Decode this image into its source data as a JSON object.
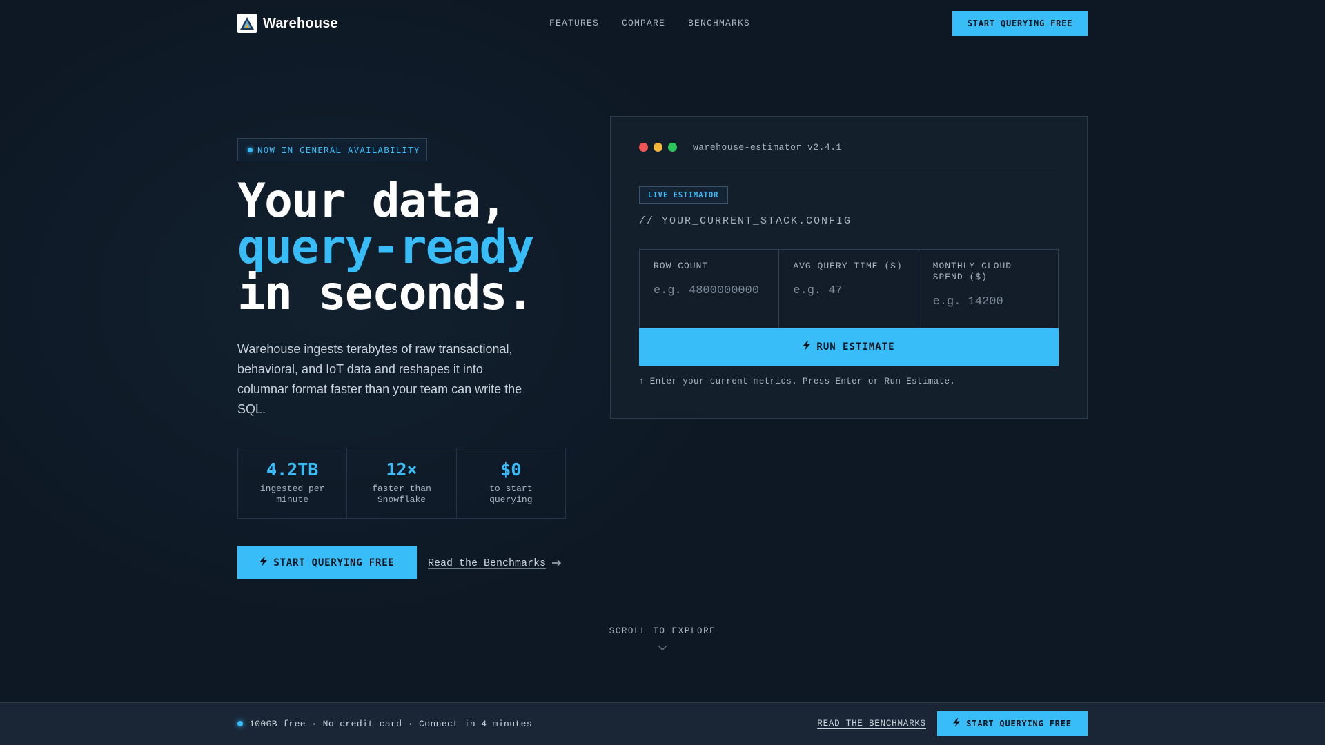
{
  "header": {
    "brand": "Warehouse",
    "nav": [
      "FEATURES",
      "COMPARE",
      "BENCHMARKS"
    ],
    "cta": "START QUERYING FREE"
  },
  "hero": {
    "badge": "NOW IN GENERAL AVAILABILITY",
    "headline_line1": "Your data,",
    "headline_line2": "query-ready",
    "headline_line3": "in seconds.",
    "lede": "Warehouse ingests terabytes of raw transactional, behavioral, and IoT data and reshapes it into columnar format faster than your team can write the SQL.",
    "stats": [
      {
        "value": "4.2TB",
        "label": "ingested per minute"
      },
      {
        "value": "12×",
        "label": "faster than Snowflake"
      },
      {
        "value": "$0",
        "label": "to start querying"
      }
    ],
    "cta_primary": "START QUERYING FREE",
    "cta_secondary": "Read the Benchmarks"
  },
  "estimator": {
    "window_title": "warehouse-estimator v2.4.1",
    "live_badge": "LIVE ESTIMATOR",
    "config_comment": "// YOUR_CURRENT_STACK.CONFIG",
    "fields": [
      {
        "label": "ROW COUNT",
        "placeholder": "e.g. 4800000000"
      },
      {
        "label": "AVG QUERY TIME (S)",
        "placeholder": "e.g. 47"
      },
      {
        "label": "MONTHLY CLOUD SPEND ($)",
        "placeholder": "e.g. 14200"
      }
    ],
    "run_label": "RUN ESTIMATE",
    "hint": "↑ Enter your current metrics. Press Enter or Run Estimate."
  },
  "scroll": {
    "label": "SCROLL TO EXPLORE"
  },
  "bottom_bar": {
    "text": "100GB free · No credit card · Connect in 4 minutes",
    "link": "READ THE BENCHMARKS",
    "cta": "START QUERYING FREE"
  },
  "colors": {
    "accent": "#38bdf8",
    "background": "#0d1824",
    "panel": "#141f2c"
  },
  "icons": [
    "warehouse-logo-icon",
    "bolt-icon",
    "arrow-right-icon",
    "chevron-down-icon"
  ]
}
